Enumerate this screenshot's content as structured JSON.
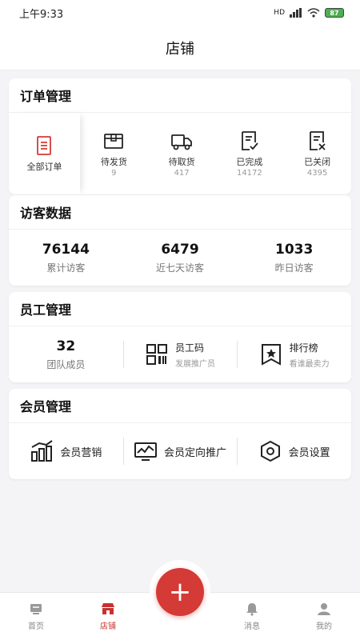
{
  "status_bar": {
    "time": "上午9:33",
    "battery": "87",
    "hd": "HD"
  },
  "header": {
    "title": "店铺"
  },
  "order_management": {
    "title": "订单管理",
    "items": [
      {
        "label": "全部订单",
        "count": "",
        "icon": "all-orders-icon"
      },
      {
        "label": "待发货",
        "count": "9",
        "icon": "box-icon"
      },
      {
        "label": "待取货",
        "count": "417",
        "icon": "truck-icon"
      },
      {
        "label": "已完成",
        "count": "14172",
        "icon": "check-doc-icon"
      },
      {
        "label": "已关闭",
        "count": "4395",
        "icon": "closed-doc-icon"
      }
    ]
  },
  "visitor_data": {
    "title": "访客数据",
    "stats": [
      {
        "value": "76144",
        "label": "累计访客"
      },
      {
        "value": "6479",
        "label": "近七天访客"
      },
      {
        "value": "1033",
        "label": "昨日访客"
      }
    ]
  },
  "staff_management": {
    "title": "员工管理",
    "team_count": "32",
    "team_label": "团队成员",
    "code_title": "员工码",
    "code_sub": "发展推广员",
    "rank_title": "排行榜",
    "rank_sub": "看谁最卖力"
  },
  "member_management": {
    "title": "会员管理",
    "marketing": "会员营销",
    "targeted": "会员定向推广",
    "settings": "会员设置"
  },
  "tabbar": {
    "home": "首页",
    "shop": "店铺",
    "messages": "消息",
    "mine": "我的",
    "fab": "+"
  },
  "colors": {
    "accent": "#d43a36",
    "active_tab": "#c8312f"
  }
}
